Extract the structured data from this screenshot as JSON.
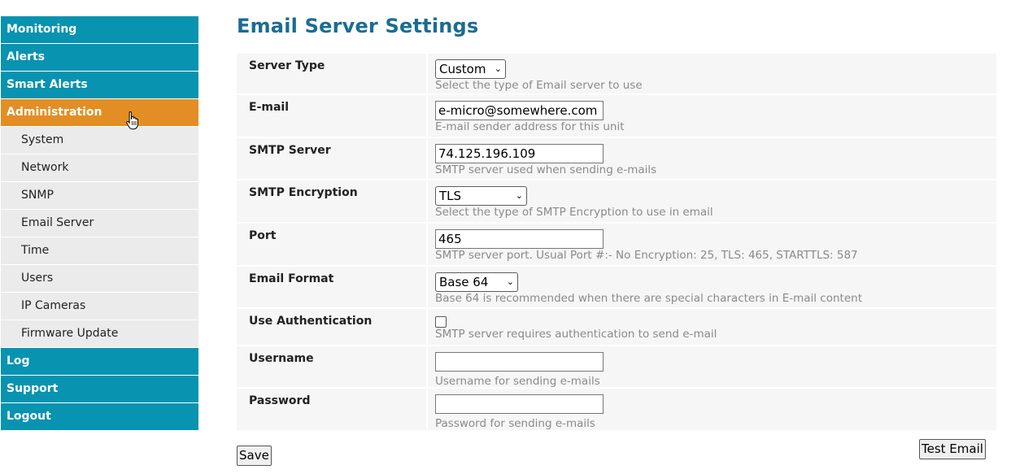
{
  "sidebar": {
    "items": [
      {
        "label": "Monitoring"
      },
      {
        "label": "Alerts"
      },
      {
        "label": "Smart Alerts"
      },
      {
        "label": "Administration"
      }
    ],
    "subitems": [
      {
        "label": "System"
      },
      {
        "label": "Network"
      },
      {
        "label": "SNMP"
      },
      {
        "label": "Email Server"
      },
      {
        "label": "Time"
      },
      {
        "label": "Users"
      },
      {
        "label": "IP Cameras"
      },
      {
        "label": "Firmware Update"
      }
    ],
    "bottom_items": [
      {
        "label": "Log"
      },
      {
        "label": "Support"
      },
      {
        "label": "Logout"
      }
    ],
    "active_color": "#e38e24",
    "main_color": "#0893b0"
  },
  "page": {
    "title": "Email Server Settings"
  },
  "fields": {
    "server_type": {
      "label": "Server Type",
      "value": "Custom",
      "hint": "Select the type of Email server to use"
    },
    "email": {
      "label": "E-mail",
      "value": "e-micro@somewhere.com",
      "hint": "E-mail sender address for this unit"
    },
    "smtp_server": {
      "label": "SMTP Server",
      "value": "74.125.196.109",
      "hint": "SMTP server used when sending e-mails"
    },
    "smtp_encryption": {
      "label": "SMTP Encryption",
      "value": "TLS",
      "hint": "Select the type of SMTP Encryption to use in email"
    },
    "port": {
      "label": "Port",
      "value": "465",
      "hint": "SMTP server port. Usual Port #:- No Encryption: 25, TLS: 465, STARTTLS: 587"
    },
    "email_format": {
      "label": "Email Format",
      "value": "Base 64",
      "hint": "Base 64 is recommended when there are special characters in E-mail content"
    },
    "use_auth": {
      "label": "Use Authentication",
      "checked": false,
      "hint": "SMTP server requires authentication to send e-mail"
    },
    "username": {
      "label": "Username",
      "value": "",
      "hint": "Username for sending e-mails"
    },
    "password": {
      "label": "Password",
      "value": "",
      "hint": "Password for sending e-mails"
    }
  },
  "buttons": {
    "save": "Save",
    "test_email": "Test Email"
  },
  "icons": {
    "dropdown": "chevron-down-icon",
    "cursor": "hand-pointer-icon"
  }
}
